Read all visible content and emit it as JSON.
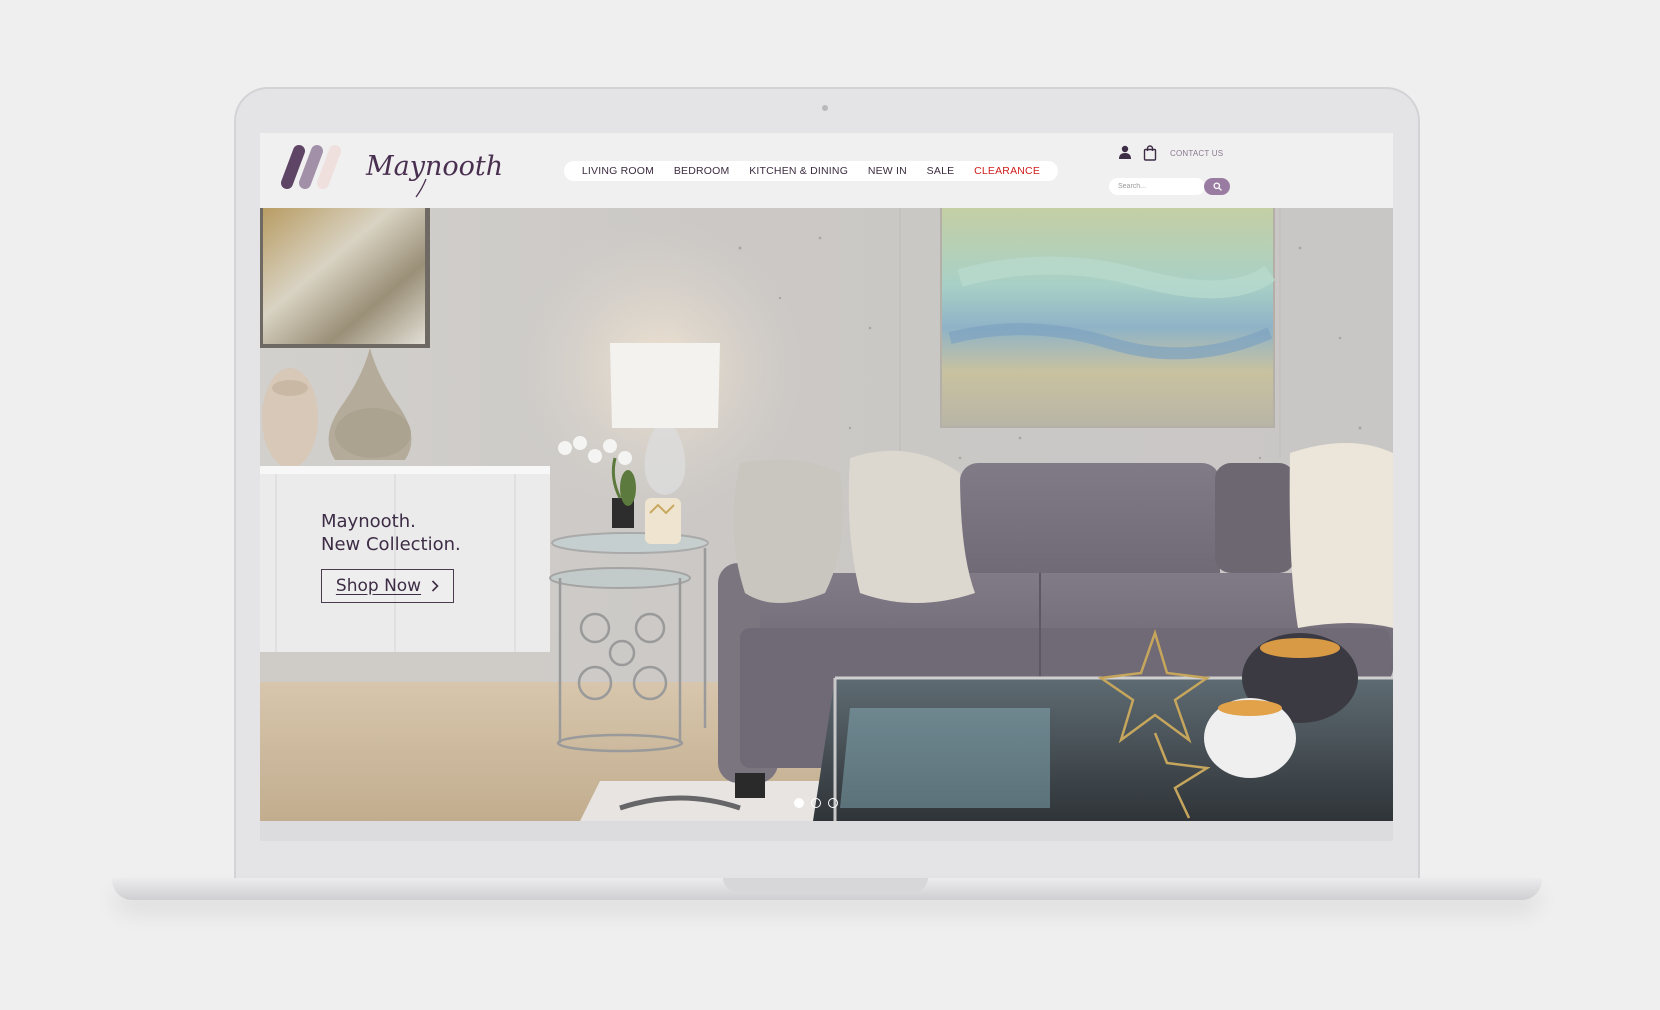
{
  "brand": {
    "name": "Maynooth",
    "colors": {
      "primary": "#3d2c45",
      "accent": "#9a7ca2",
      "clearance": "#d21d1d",
      "logo_dark": "#5e4566",
      "logo_mid": "#a190a8",
      "logo_light": "#efe0de"
    }
  },
  "nav": {
    "items": [
      {
        "label": "LIVING ROOM"
      },
      {
        "label": "BEDROOM"
      },
      {
        "label": "KITCHEN & DINING"
      },
      {
        "label": "NEW IN"
      },
      {
        "label": "SALE"
      },
      {
        "label": "CLEARANCE"
      }
    ]
  },
  "utility": {
    "contact_label": "CONTACT US",
    "account_icon": "user-icon",
    "cart_icon": "shopping-bag-icon"
  },
  "search": {
    "placeholder": "Search...",
    "button_icon": "search-icon"
  },
  "hero": {
    "headline_line1": "Maynooth.",
    "headline_line2": "New Collection.",
    "cta_label": "Shop Now",
    "cta_icon": "chevron-right-icon",
    "slides": 3,
    "active_slide": 1
  }
}
